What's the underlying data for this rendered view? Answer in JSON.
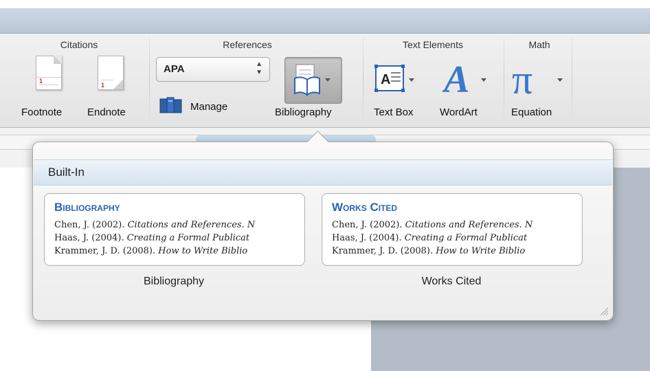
{
  "ribbon": {
    "groups": {
      "citations": "Citations",
      "references": "References",
      "text_elements": "Text Elements",
      "math": "Math"
    },
    "footnote_label": "Footnote",
    "endnote_label": "Endnote",
    "style_select": {
      "value": "APA"
    },
    "manage_label": "Manage",
    "bibliography_label": "Bibliography",
    "textbox_label": "Text Box",
    "wordart_label": "WordArt",
    "equation_label": "Equation"
  },
  "popover": {
    "section_title": "Built-In",
    "cards": [
      {
        "heading": "Bibliography",
        "label": "Bibliography",
        "entries": [
          {
            "prefix": "Chen, J. (2002). ",
            "title": "Citations and References. N"
          },
          {
            "prefix": "Haas, J. (2004). ",
            "title": "Creating a Formal Publicat"
          },
          {
            "prefix": "Krammer, J. D. (2008). ",
            "title": "How to Write Biblio"
          }
        ]
      },
      {
        "heading": "Works Cited",
        "label": "Works Cited",
        "entries": [
          {
            "prefix": "Chen, J. (2002). ",
            "title": "Citations and References. N"
          },
          {
            "prefix": "Haas, J. (2004). ",
            "title": "Creating a Formal Publicat"
          },
          {
            "prefix": "Krammer, J. D. (2008). ",
            "title": "How to Write Biblio"
          }
        ]
      }
    ]
  },
  "colors": {
    "accent_blue": "#2a64b4",
    "title_bar": "#c3cfdc",
    "ribbon": "#e9e9e9",
    "selected_button": "#b5b5b5"
  }
}
